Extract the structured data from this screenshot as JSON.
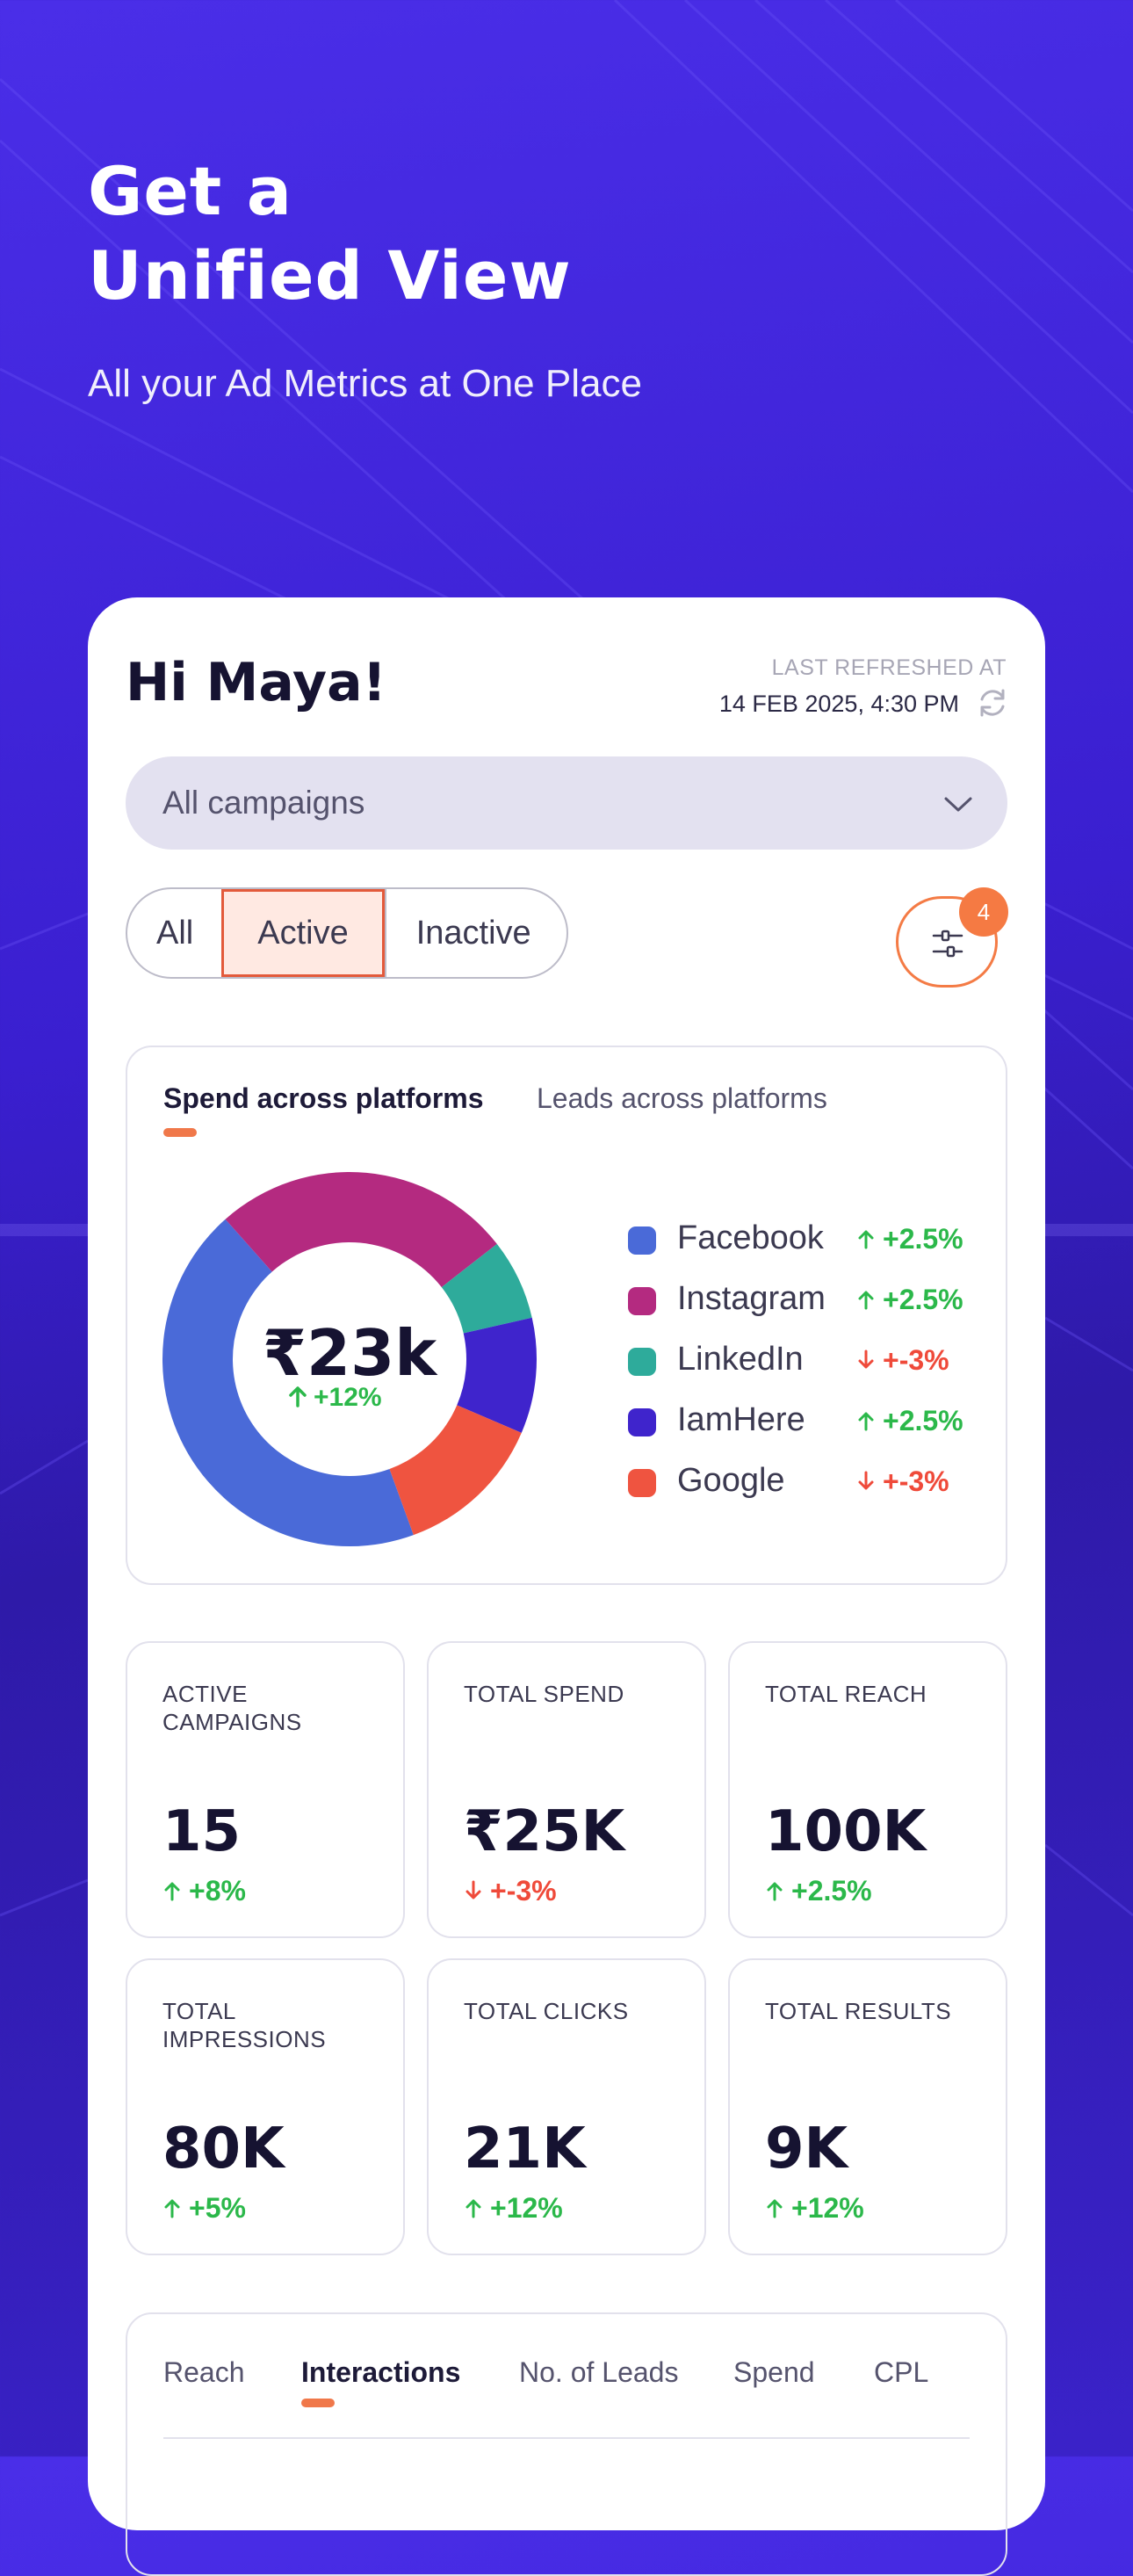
{
  "hero": {
    "title_line1": "Get a",
    "title_line2": "Unified View",
    "subtitle": "All your Ad Metrics at One Place"
  },
  "header": {
    "greeting": "Hi Maya!",
    "refresh_label": "LAST REFRESHED AT",
    "refresh_time": "14 FEB 2025, 4:30 PM",
    "refresh_icon": "refresh-icon"
  },
  "campaign_select": {
    "selected": "All campaigns",
    "icon": "chevron-down-icon"
  },
  "status_filter": {
    "options": [
      "All",
      "Active",
      "Inactive"
    ],
    "selected": "Active"
  },
  "filter_button": {
    "icon": "sliders-icon",
    "badge": "4"
  },
  "platform_panel": {
    "tabs": [
      "Spend across platforms",
      "Leads across platforms"
    ],
    "active_tab": "Spend across platforms",
    "center_value": "₹23k",
    "center_delta": "+12%",
    "legend": [
      {
        "name": "Facebook",
        "delta": "+2.5%",
        "dir": "up",
        "color": "#4a6ad8"
      },
      {
        "name": "Instagram",
        "delta": "+2.5%",
        "dir": "up",
        "color": "#b42a80"
      },
      {
        "name": "LinkedIn",
        "delta": "+-3%",
        "dir": "down",
        "color": "#2eab9b"
      },
      {
        "name": "IamHere",
        "delta": "+2.5%",
        "dir": "up",
        "color": "#3f24cc"
      },
      {
        "name": "Google",
        "delta": "+-3%",
        "dir": "down",
        "color": "#ef5440"
      }
    ]
  },
  "stats": [
    {
      "label": "ACTIVE CAMPAIGNS",
      "value": "15",
      "delta": "+8%",
      "dir": "up"
    },
    {
      "label": "TOTAL SPEND",
      "value": "₹25K",
      "delta": "+-3%",
      "dir": "down"
    },
    {
      "label": "TOTAL REACH",
      "value": "100K",
      "delta": "+2.5%",
      "dir": "up"
    },
    {
      "label": "TOTAL IMPRESSIONS",
      "value": "80K",
      "delta": "+5%",
      "dir": "up"
    },
    {
      "label": "TOTAL CLICKS",
      "value": "21K",
      "delta": "+12%",
      "dir": "up"
    },
    {
      "label": "TOTAL RESULTS",
      "value": "9K",
      "delta": "+12%",
      "dir": "up"
    }
  ],
  "metric_tabs": {
    "tabs": [
      "Reach",
      "Interactions",
      "No. of Leads",
      "Spend",
      "CPL"
    ],
    "active": "Interactions"
  },
  "colors": {
    "accent": "#f0784a",
    "positive": "#2bb84a",
    "negative": "#ef4a3a",
    "background": "#3a1fd0"
  }
}
